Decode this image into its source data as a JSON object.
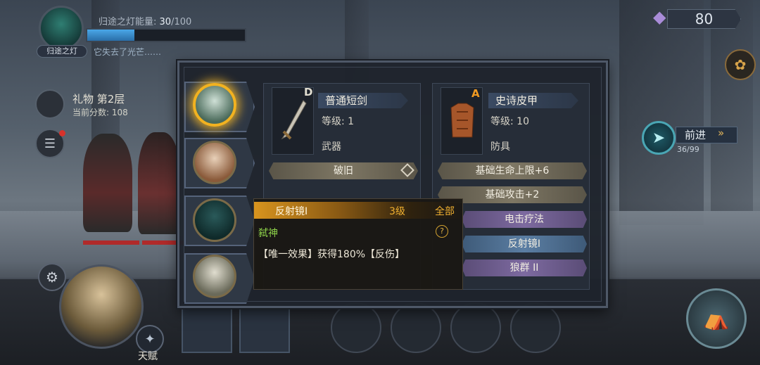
{
  "hud": {
    "lamp_name": "归途之灯",
    "energy_label": "归途之灯能量:",
    "energy_current": "30",
    "energy_max": "/100",
    "energy_fraction": 0.3,
    "lamp_status": "它失去了光芒……",
    "crystal_count": "80"
  },
  "floor": {
    "title": "礼物  第2层",
    "score": "当前分数: 108"
  },
  "advance": {
    "label": "前进",
    "arrow": "»",
    "progress": "36/99"
  },
  "talent": {
    "label": "天赋"
  },
  "weapon": {
    "rank": "D",
    "name": "普通短剑",
    "level": "等级: 1",
    "type": "武器",
    "stats": [
      "破旧"
    ]
  },
  "armor": {
    "rank": "A",
    "name": "史诗皮甲",
    "level": "等级: 10",
    "type": "防具",
    "stats": [
      "基础生命上限+6",
      "基础攻击+2",
      "电击疗法",
      "反射镜I",
      "狼群 II"
    ]
  },
  "tooltip": {
    "name": "反射镜I",
    "level": "3级",
    "scope": "全部",
    "class": "弑神",
    "help": "?",
    "desc": "【唯一效果】获得180%【反伤】"
  },
  "icons": {
    "gift": "gift-icon",
    "chat": "chat-icon",
    "crystal": "crystal-icon",
    "map": "map-icon",
    "advance": "compass-icon",
    "settings": "gear-icon",
    "talent": "talent-icon",
    "bag": "bag-icon"
  }
}
